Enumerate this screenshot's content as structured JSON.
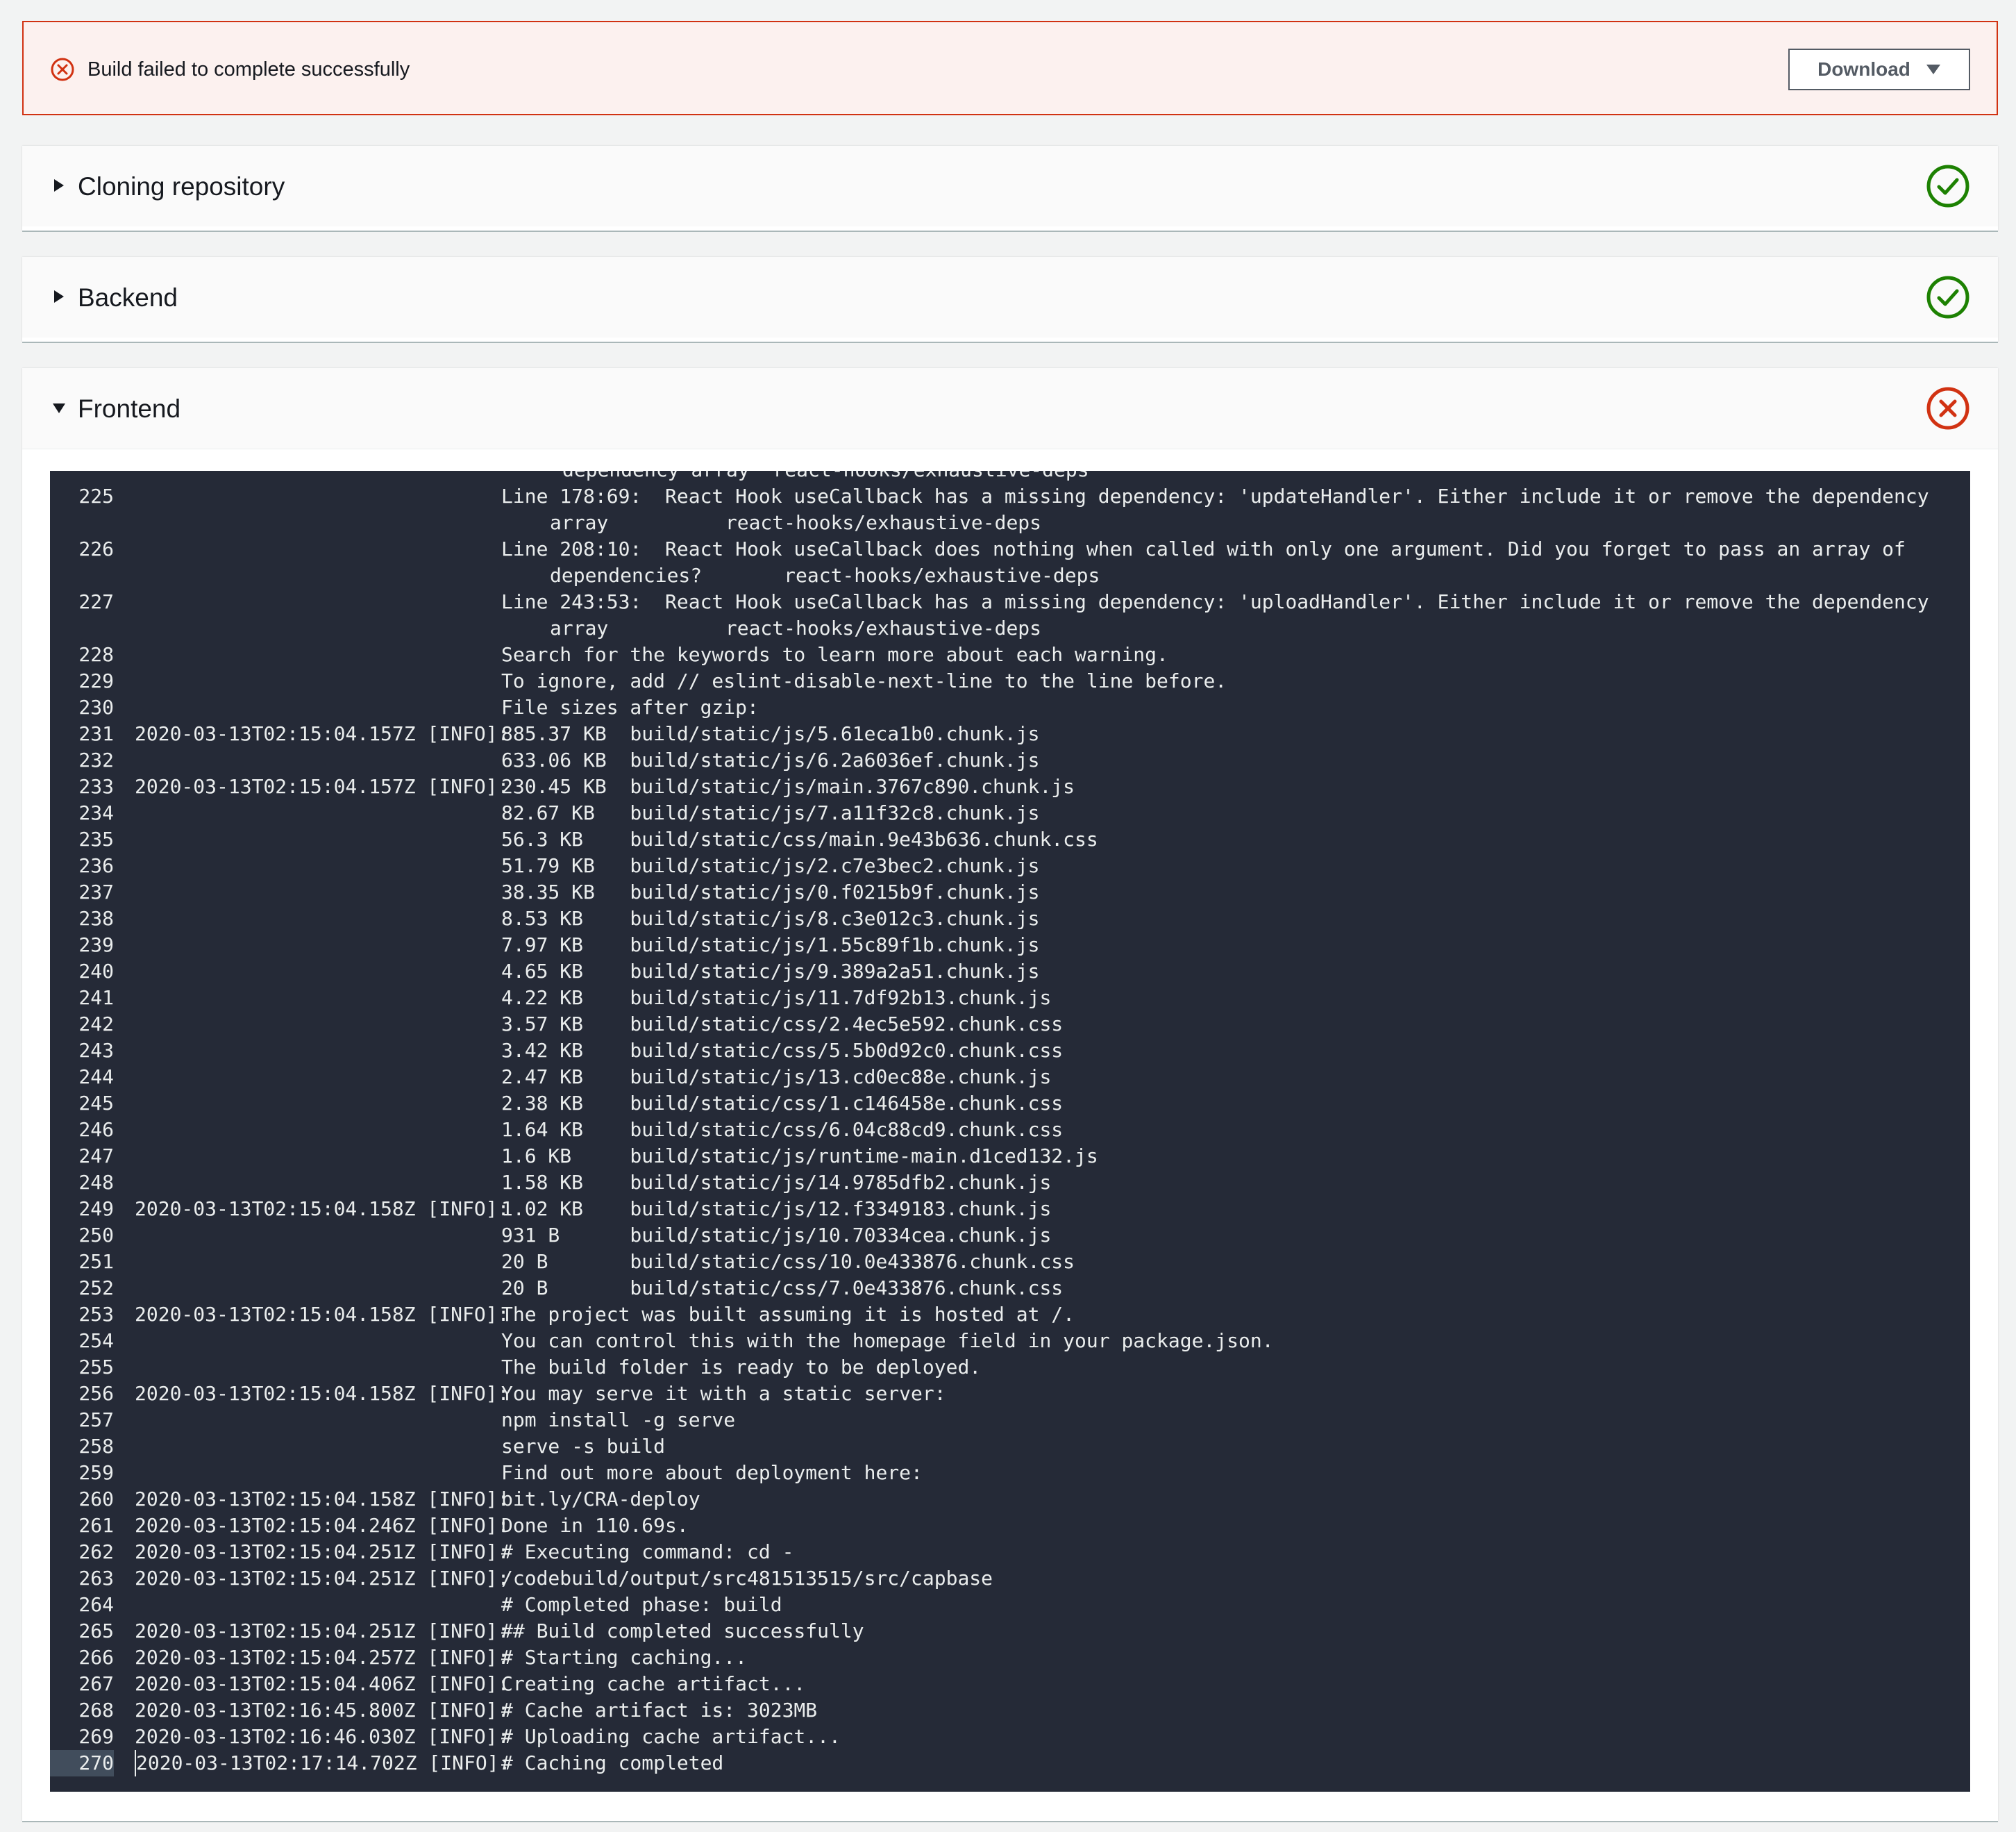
{
  "banner": {
    "message": "Build failed to complete successfully",
    "download_label": "Download",
    "error_color": "#d13212"
  },
  "sections": [
    {
      "title": "Cloning repository",
      "status": "success",
      "expanded": false
    },
    {
      "title": "Backend",
      "status": "success",
      "expanded": false
    },
    {
      "title": "Frontend",
      "status": "failed",
      "expanded": true
    }
  ],
  "colors": {
    "success": "#1d8102",
    "failed": "#d13212",
    "log_bg": "#252a37"
  },
  "log": {
    "lines": [
      {
        "n": "",
        "ts": "",
        "text": "dependency array  react-hooks/exhaustive-deps",
        "cont": true
      },
      {
        "n": "225",
        "ts": "",
        "text": "Line 178:69:  React Hook useCallback has a missing dependency: 'updateHandler'. Either include it or remove the dependency array          react-hooks/exhaustive-deps"
      },
      {
        "n": "226",
        "ts": "",
        "text": "Line 208:10:  React Hook useCallback does nothing when called with only one argument. Did you forget to pass an array of dependencies?       react-hooks/exhaustive-deps"
      },
      {
        "n": "227",
        "ts": "",
        "text": "Line 243:53:  React Hook useCallback has a missing dependency: 'uploadHandler'. Either include it or remove the dependency array          react-hooks/exhaustive-deps"
      },
      {
        "n": "228",
        "ts": "",
        "text": "Search for the keywords to learn more about each warning."
      },
      {
        "n": "229",
        "ts": "",
        "text": "To ignore, add // eslint-disable-next-line to the line before."
      },
      {
        "n": "230",
        "ts": "",
        "text": "File sizes after gzip:"
      },
      {
        "n": "231",
        "ts": "2020-03-13T02:15:04.157Z [INFO]:",
        "text": "885.37 KB  build/static/js/5.61eca1b0.chunk.js"
      },
      {
        "n": "232",
        "ts": "",
        "text": "633.06 KB  build/static/js/6.2a6036ef.chunk.js"
      },
      {
        "n": "233",
        "ts": "2020-03-13T02:15:04.157Z [INFO]:",
        "text": "230.45 KB  build/static/js/main.3767c890.chunk.js"
      },
      {
        "n": "234",
        "ts": "",
        "text": "82.67 KB   build/static/js/7.a11f32c8.chunk.js"
      },
      {
        "n": "235",
        "ts": "",
        "text": "56.3 KB    build/static/css/main.9e43b636.chunk.css"
      },
      {
        "n": "236",
        "ts": "",
        "text": "51.79 KB   build/static/js/2.c7e3bec2.chunk.js"
      },
      {
        "n": "237",
        "ts": "",
        "text": "38.35 KB   build/static/js/0.f0215b9f.chunk.js"
      },
      {
        "n": "238",
        "ts": "",
        "text": "8.53 KB    build/static/js/8.c3e012c3.chunk.js"
      },
      {
        "n": "239",
        "ts": "",
        "text": "7.97 KB    build/static/js/1.55c89f1b.chunk.js"
      },
      {
        "n": "240",
        "ts": "",
        "text": "4.65 KB    build/static/js/9.389a2a51.chunk.js"
      },
      {
        "n": "241",
        "ts": "",
        "text": "4.22 KB    build/static/js/11.7df92b13.chunk.js"
      },
      {
        "n": "242",
        "ts": "",
        "text": "3.57 KB    build/static/css/2.4ec5e592.chunk.css"
      },
      {
        "n": "243",
        "ts": "",
        "text": "3.42 KB    build/static/css/5.5b0d92c0.chunk.css"
      },
      {
        "n": "244",
        "ts": "",
        "text": "2.47 KB    build/static/js/13.cd0ec88e.chunk.js"
      },
      {
        "n": "245",
        "ts": "",
        "text": "2.38 KB    build/static/css/1.c146458e.chunk.css"
      },
      {
        "n": "246",
        "ts": "",
        "text": "1.64 KB    build/static/css/6.04c88cd9.chunk.css"
      },
      {
        "n": "247",
        "ts": "",
        "text": "1.6 KB     build/static/js/runtime-main.d1ced132.js"
      },
      {
        "n": "248",
        "ts": "",
        "text": "1.58 KB    build/static/js/14.9785dfb2.chunk.js"
      },
      {
        "n": "249",
        "ts": "2020-03-13T02:15:04.158Z [INFO]:",
        "text": "1.02 KB    build/static/js/12.f3349183.chunk.js"
      },
      {
        "n": "250",
        "ts": "",
        "text": "931 B      build/static/js/10.70334cea.chunk.js"
      },
      {
        "n": "251",
        "ts": "",
        "text": "20 B       build/static/css/10.0e433876.chunk.css"
      },
      {
        "n": "252",
        "ts": "",
        "text": "20 B       build/static/css/7.0e433876.chunk.css"
      },
      {
        "n": "253",
        "ts": "2020-03-13T02:15:04.158Z [INFO]:",
        "text": "The project was built assuming it is hosted at /."
      },
      {
        "n": "254",
        "ts": "",
        "text": "You can control this with the homepage field in your package.json."
      },
      {
        "n": "255",
        "ts": "",
        "text": "The build folder is ready to be deployed."
      },
      {
        "n": "256",
        "ts": "2020-03-13T02:15:04.158Z [INFO]:",
        "text": "You may serve it with a static server:"
      },
      {
        "n": "257",
        "ts": "",
        "text": "npm install -g serve"
      },
      {
        "n": "258",
        "ts": "",
        "text": "serve -s build"
      },
      {
        "n": "259",
        "ts": "",
        "text": "Find out more about deployment here:"
      },
      {
        "n": "260",
        "ts": "2020-03-13T02:15:04.158Z [INFO]:",
        "text": "bit.ly/CRA-deploy"
      },
      {
        "n": "261",
        "ts": "2020-03-13T02:15:04.246Z [INFO]:",
        "text": "Done in 110.69s."
      },
      {
        "n": "262",
        "ts": "2020-03-13T02:15:04.251Z [INFO]:",
        "text": "# Executing command: cd -"
      },
      {
        "n": "263",
        "ts": "2020-03-13T02:15:04.251Z [INFO]:",
        "text": "/codebuild/output/src481513515/src/capbase"
      },
      {
        "n": "264",
        "ts": "",
        "text": "# Completed phase: build"
      },
      {
        "n": "265",
        "ts": "2020-03-13T02:15:04.251Z [INFO]:",
        "text": "## Build completed successfully"
      },
      {
        "n": "266",
        "ts": "2020-03-13T02:15:04.257Z [INFO]:",
        "text": "# Starting caching..."
      },
      {
        "n": "267",
        "ts": "2020-03-13T02:15:04.406Z [INFO]:",
        "text": "Creating cache artifact..."
      },
      {
        "n": "268",
        "ts": "2020-03-13T02:16:45.800Z [INFO]:",
        "text": "# Cache artifact is: 3023MB"
      },
      {
        "n": "269",
        "ts": "2020-03-13T02:16:46.030Z [INFO]:",
        "text": "# Uploading cache artifact..."
      },
      {
        "n": "270",
        "ts": "2020-03-13T02:17:14.702Z [INFO]:",
        "text": "# Caching completed",
        "current": true
      }
    ]
  }
}
